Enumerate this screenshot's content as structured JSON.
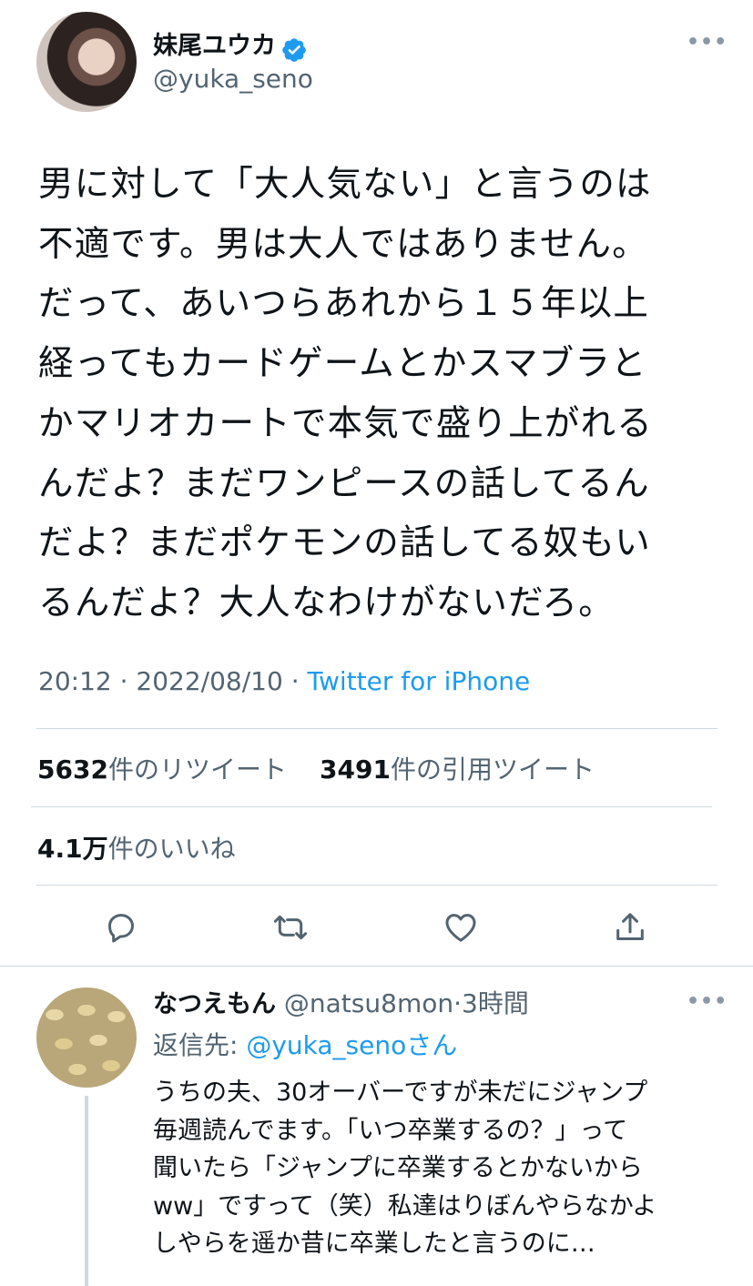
{
  "tweet": {
    "author_name": "妹尾ユウカ",
    "author_handle": "@yuka_seno",
    "text": "男に対して「大人気ない」と言うのは\n不適です。男は大人ではありません。\nだって、あいつらあれから１５年以上\n経ってもカードゲームとかスマブラと\nかマリオカートで本気で盛り上がれる\nんだよ？まだワンピースの話してるん\nだよ？まだポケモンの話してる奴もい\nるんだよ？大人なわけがないだろ。",
    "time": "20:12",
    "date": "2022/08/10",
    "separator": "·",
    "source": "Twitter for iPhone",
    "retweets_count": "5632",
    "retweets_label": "件のリツイート",
    "quotes_count": "3491",
    "quotes_label": "件の引用ツイート",
    "likes_count": "4.1万",
    "likes_label": "件のいいね",
    "more": "•••"
  },
  "actions": [
    "reply-icon",
    "retweet-icon",
    "like-icon",
    "share-icon"
  ],
  "reply": {
    "author_name": "なつえもん",
    "author_handle": "@natsu8mon",
    "separator": "·",
    "time": "3時間",
    "reply_to_label": "返信先: ",
    "reply_to_handle": "@yuka_seno",
    "reply_to_suffix": "さん",
    "text": "うちの夫、30オーバーですが未だにジャンプ\n毎週読んでます。「いつ卒業するの？」って\n聞いたら「ジャンプに卒業するとかないから\nww」ですって（笑）私達はりぼんやらなかよ\nしやらを遥か昔に卒業したと言うのに…",
    "more": "•••"
  },
  "colors": {
    "accent": "#1d9bf0",
    "muted": "#536471",
    "divider": "#cfd9de",
    "text": "#0f1419"
  }
}
